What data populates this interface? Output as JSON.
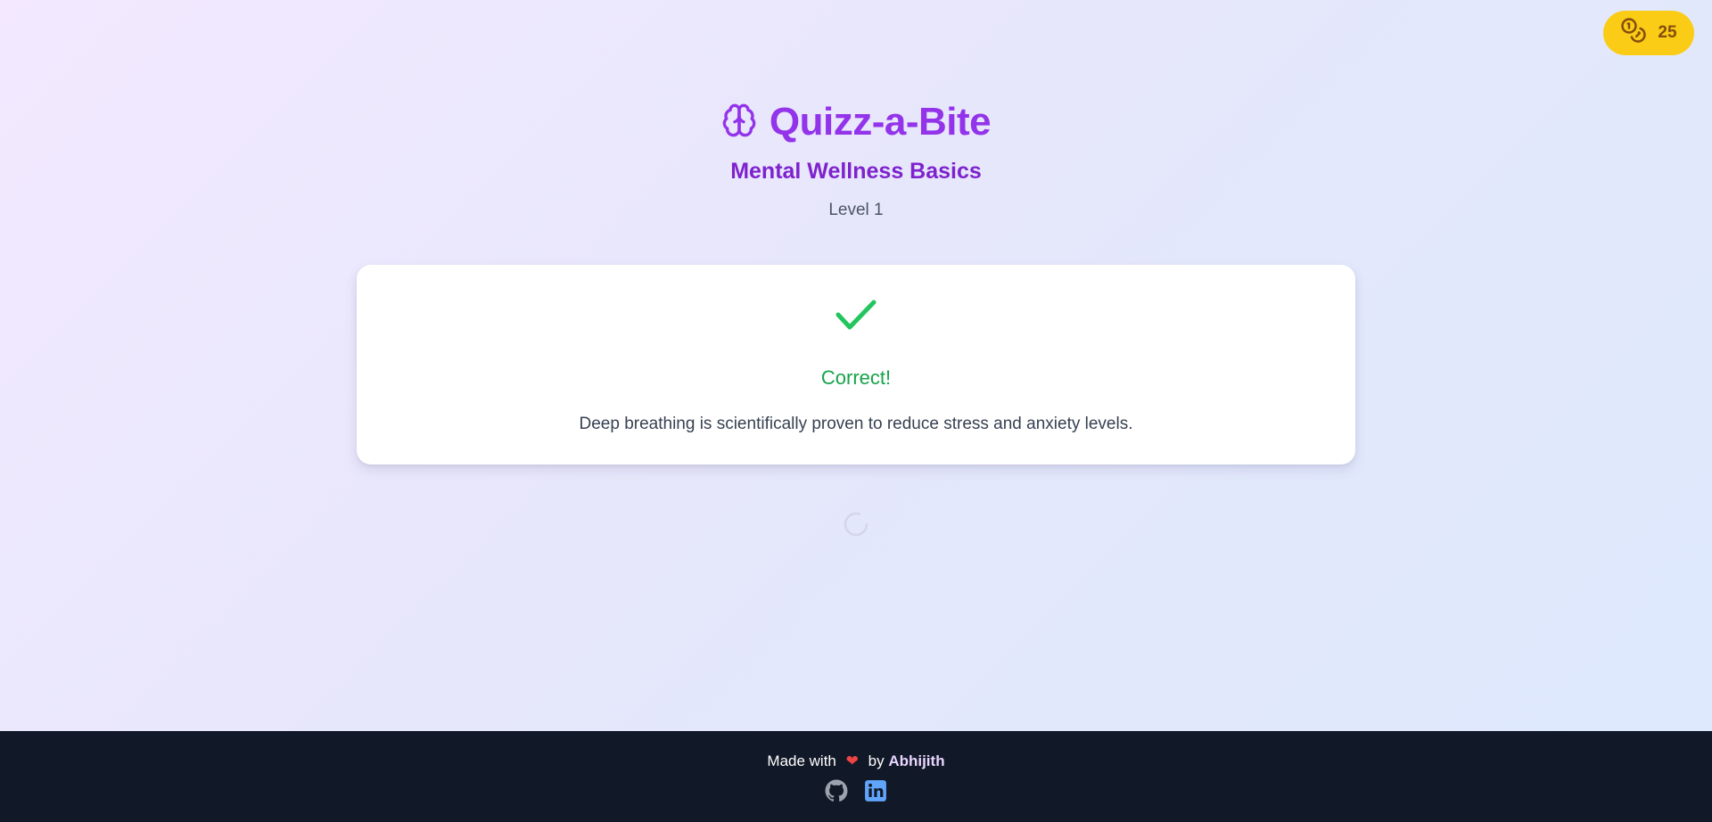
{
  "coins": {
    "count": "25",
    "icon": "coins-icon"
  },
  "header": {
    "icon": "brain-icon",
    "title": "Quizz-a-Bite",
    "subtitle": "Mental Wellness Basics",
    "level": "Level 1"
  },
  "feedback": {
    "icon": "check-icon",
    "result": "Correct!",
    "explanation": "Deep breathing is scientifically proven to reduce stress and anxiety levels."
  },
  "footer": {
    "made_with": "Made with",
    "heart": "❤",
    "by": "by",
    "author": "Abhijith",
    "links": [
      {
        "name": "GitHub",
        "icon": "github-icon"
      },
      {
        "name": "LinkedIn",
        "icon": "linkedin-icon"
      }
    ]
  },
  "colors": {
    "accent": "#9333ea",
    "coin_badge": "#facc15",
    "success": "#16a34a",
    "footer_bg": "#111827",
    "linkedin": "#60a5fa"
  }
}
